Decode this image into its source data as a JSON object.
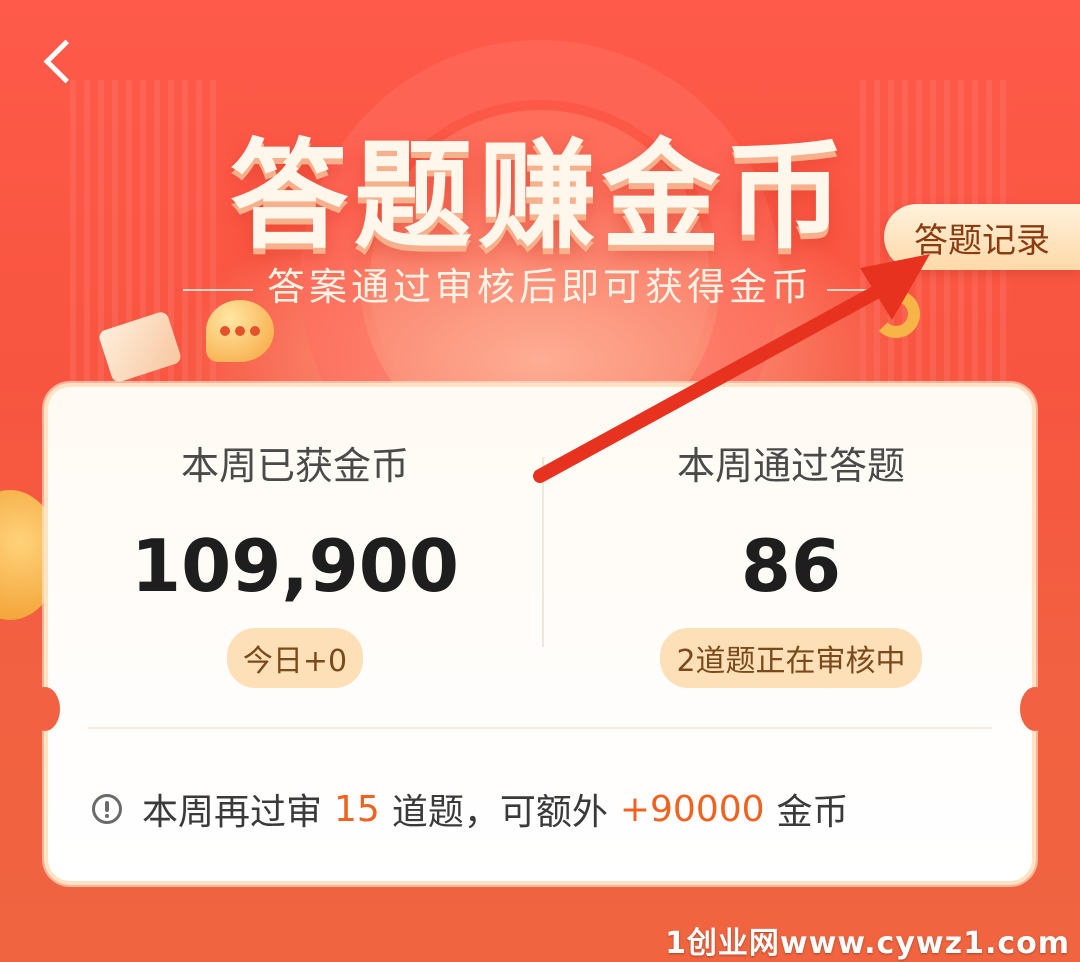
{
  "header": {
    "back_icon": "chevron-left-icon",
    "title": "答题赚金币",
    "subtitle": "答案通过审核后即可获得金币",
    "record_button": "答题记录"
  },
  "stats": {
    "coins": {
      "label": "本周已获金币",
      "value": "109,900",
      "badge": "今日+0"
    },
    "questions": {
      "label": "本周通过答题",
      "value": "86",
      "badge": "2道题正在审核中"
    }
  },
  "tip": {
    "icon": "info-circle-icon",
    "prefix": "本周再过审",
    "count": "15",
    "middle": "道题，可额外",
    "bonus": "+90000",
    "suffix": "金币"
  },
  "watermark": "1创业网www.cywz1.com",
  "colors": {
    "accent": "#f0621f",
    "background": "#f35a45",
    "arrow": "#e6321e"
  }
}
